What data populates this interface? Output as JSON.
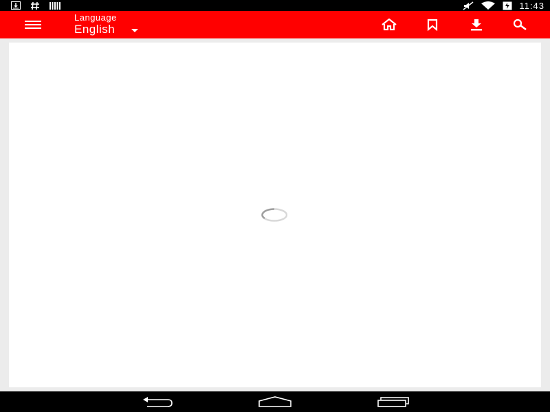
{
  "status_bar": {
    "clock": "11:43",
    "left_icons": [
      "download-icon",
      "hash-icon",
      "barcode-icon"
    ],
    "right_icons": [
      "mute-icon",
      "wifi-icon",
      "battery-charging-icon"
    ]
  },
  "app_bar": {
    "background": "#ff0000",
    "language_label": "Language",
    "language_value": "English",
    "actions": [
      "home-icon",
      "bookmark-icon",
      "download-icon",
      "search-icon"
    ]
  },
  "content": {
    "state": "loading",
    "spinner": "loading-spinner"
  },
  "nav_bar": {
    "buttons": [
      "back-icon",
      "home-icon",
      "recents-icon"
    ]
  }
}
